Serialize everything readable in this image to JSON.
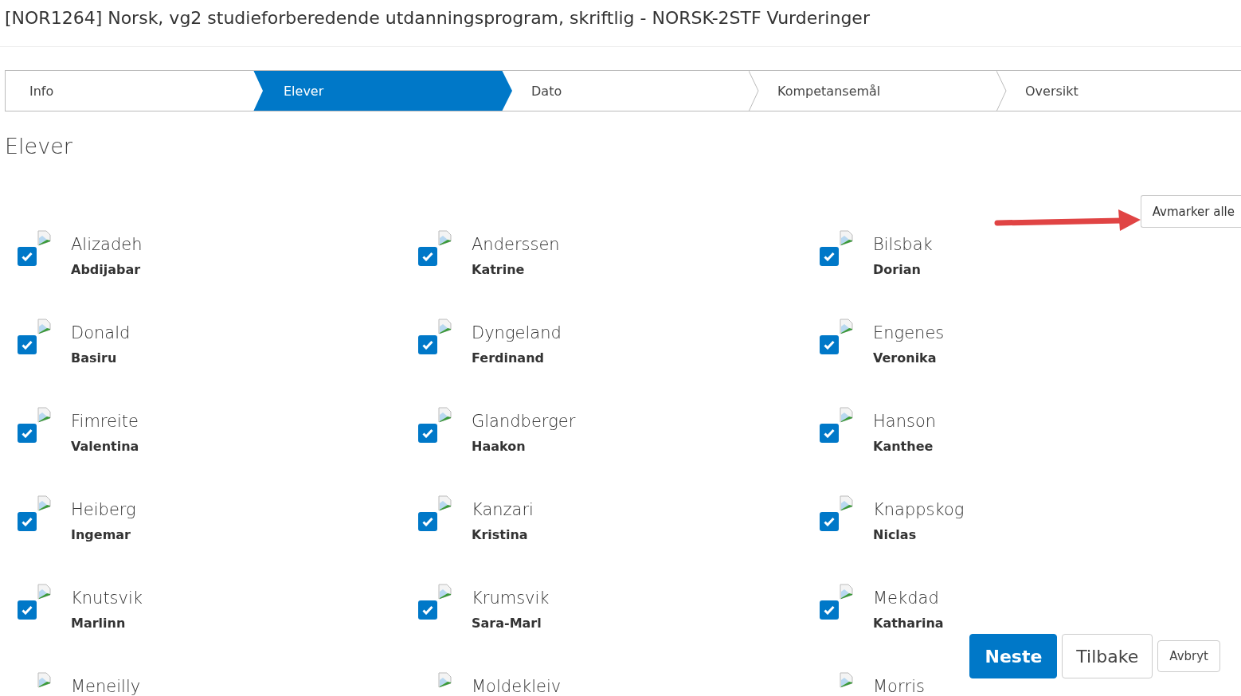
{
  "page_title": "[NOR1264] Norsk, vg2 studieforberedende utdanningsprogram, skriftlig - NORSK-2STF Vurderinger",
  "steps": [
    {
      "label": "Info",
      "selected": false
    },
    {
      "label": "Elever",
      "selected": true
    },
    {
      "label": "Dato",
      "selected": false
    },
    {
      "label": "Kompetansemål",
      "selected": false
    },
    {
      "label": "Oversikt",
      "selected": false
    }
  ],
  "section_heading": "Elever",
  "deselect_all_button": "Avmarker alle",
  "students": [
    {
      "surname": "Alizadeh",
      "first_name": "Abdijabar",
      "checked": true
    },
    {
      "surname": "Anderssen",
      "first_name": "Katrine",
      "checked": true
    },
    {
      "surname": "Bilsbak",
      "first_name": "Dorian",
      "checked": true
    },
    {
      "surname": "Donald",
      "first_name": "Basiru",
      "checked": true
    },
    {
      "surname": "Dyngeland",
      "first_name": "Ferdinand",
      "checked": true
    },
    {
      "surname": "Engenes",
      "first_name": "Veronika",
      "checked": true
    },
    {
      "surname": "Fimreite",
      "first_name": "Valentina",
      "checked": true
    },
    {
      "surname": "Glandberger",
      "first_name": "Haakon",
      "checked": true
    },
    {
      "surname": "Hanson",
      "first_name": "Kanthee",
      "checked": true
    },
    {
      "surname": "Heiberg",
      "first_name": "Ingemar",
      "checked": true
    },
    {
      "surname": "Kanzari",
      "first_name": "Kristina",
      "checked": true
    },
    {
      "surname": "Knappskog",
      "first_name": "Niclas",
      "checked": true
    },
    {
      "surname": "Knutsvik",
      "first_name": "Marlinn",
      "checked": true
    },
    {
      "surname": "Krumsvik",
      "first_name": "Sara-Marl",
      "checked": true
    },
    {
      "surname": "Mekdad",
      "first_name": "Katharina",
      "checked": true
    },
    {
      "surname": "Meneilly"
    },
    {
      "surname": "Moldekleiv"
    },
    {
      "surname": "Morris"
    }
  ],
  "actions": [
    {
      "label": "Neste",
      "kind": "primary"
    },
    {
      "label": "Tilbake",
      "kind": "secondary"
    },
    {
      "label": "Avbryt",
      "kind": "small"
    }
  ]
}
